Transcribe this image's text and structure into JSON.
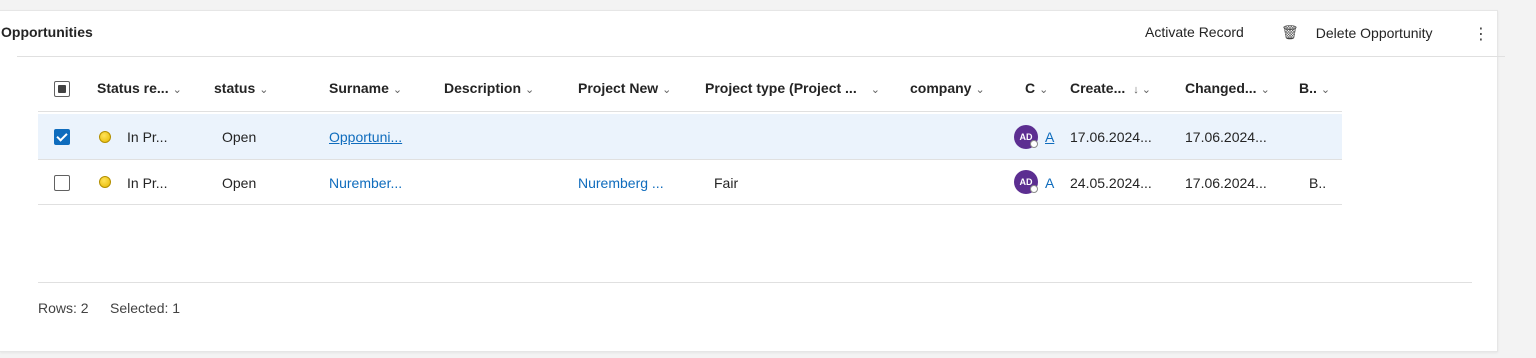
{
  "grid": {
    "title": "Opportunities",
    "commands": {
      "activate": "Activate Record",
      "delete": "Delete Opportunity",
      "more": "⋮",
      "delete_icon": "trash-icon"
    },
    "columns": [
      {
        "label": "Status re...",
        "sort": "⌄"
      },
      {
        "label": "status",
        "sort": "⌄"
      },
      {
        "label": "Surname",
        "sort": "⌄"
      },
      {
        "label": "Description",
        "sort": "⌄"
      },
      {
        "label": "Project New",
        "sort": "⌄"
      },
      {
        "label": "Project type (Project ...",
        "sort": "⌄"
      },
      {
        "label": "company",
        "sort": "⌄"
      },
      {
        "label": "C",
        "sort": "⌄"
      },
      {
        "label": "Create...",
        "sort": "↓ ⌄"
      },
      {
        "label": "Changed...",
        "sort": "⌄"
      },
      {
        "label": "B..",
        "sort": "⌄"
      }
    ],
    "rows": [
      {
        "selected": true,
        "status_reason": "In Pr...",
        "status": "Open",
        "surname": "Opportuni...",
        "description": "",
        "project_new": "",
        "project_type": "",
        "company": "",
        "owner_initials": "AD",
        "owner": "A",
        "created": "17.06.2024...",
        "changed": "17.06.2024...",
        "b": ""
      },
      {
        "selected": false,
        "status_reason": "In Pr...",
        "status": "Open",
        "surname": "Nurember...",
        "description": "",
        "project_new": "Nuremberg ...",
        "project_type": "Fair",
        "company": "",
        "owner_initials": "AD",
        "owner": "A",
        "created": "24.05.2024...",
        "changed": "17.06.2024...",
        "b": "B.."
      }
    ],
    "footer": {
      "rows": "Rows: 2",
      "selected": "Selected: 1"
    },
    "colors": {
      "accent": "#0f6cbd",
      "avatar": "#5c2e91",
      "selected_row": "#ebf3fc",
      "status_dot": "#f2c811"
    }
  }
}
